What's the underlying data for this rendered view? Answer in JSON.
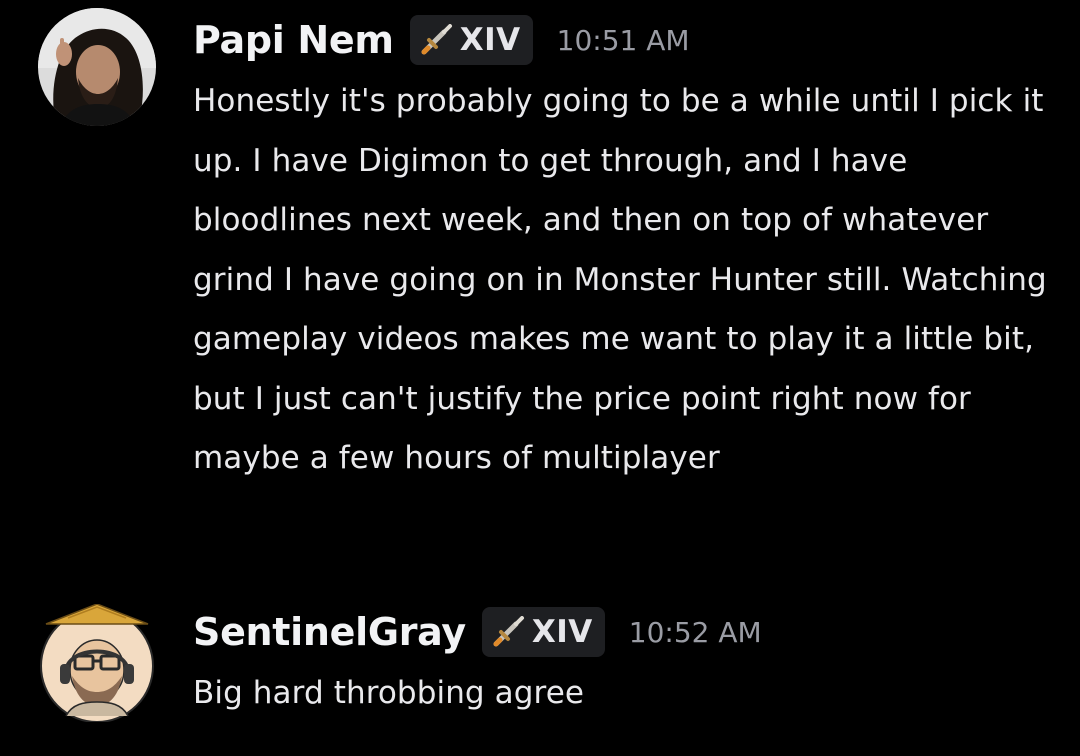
{
  "messages": [
    {
      "username": "Papi Nem",
      "tag": {
        "icon": "sword-icon",
        "label": "XIV"
      },
      "timestamp": "10:51 AM",
      "text": "Honestly it's probably going to be a while until I pick it up. I have Digimon to get through, and I have bloodlines next week, and then on top of whatever grind I have going on in Monster Hunter still. Watching gameplay videos makes me want to play it a little bit, but I just can't justify the price point right now for maybe a few hours of multiplayer"
    },
    {
      "username": "SentinelGray",
      "tag": {
        "icon": "sword-icon",
        "label": "XIV"
      },
      "timestamp": "10:52 AM",
      "text": "Big hard throbbing agree"
    }
  ],
  "colors": {
    "background": "#000000",
    "username": "#f2f3f5",
    "timestamp": "#9a9ca4",
    "tag_background": "#1e1f22",
    "body_text": "#e9e9ec"
  }
}
